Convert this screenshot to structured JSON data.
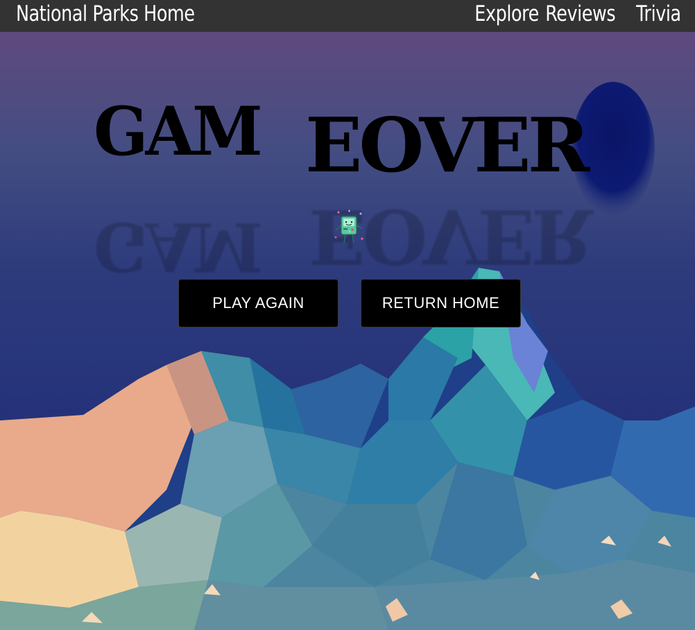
{
  "nav": {
    "home": "National Parks Home",
    "links": [
      "Explore",
      "Reviews",
      "Trivia"
    ]
  },
  "game": {
    "title_part1": "GAM",
    "title_part2": "EOVER",
    "buttons": {
      "play_again": "PLAY AGAIN",
      "return_home": "RETURN HOME"
    },
    "mascot_icon": "bmo-robot-icon"
  },
  "colors": {
    "nav_bg": "#333333",
    "nav_text": "#ffffff",
    "button_bg": "#000000",
    "button_text": "#ffffff",
    "title_text": "#000000",
    "sky_top": "#5f4a7e",
    "sky_bottom": "#23307a",
    "moon": "#0a1a6e"
  }
}
